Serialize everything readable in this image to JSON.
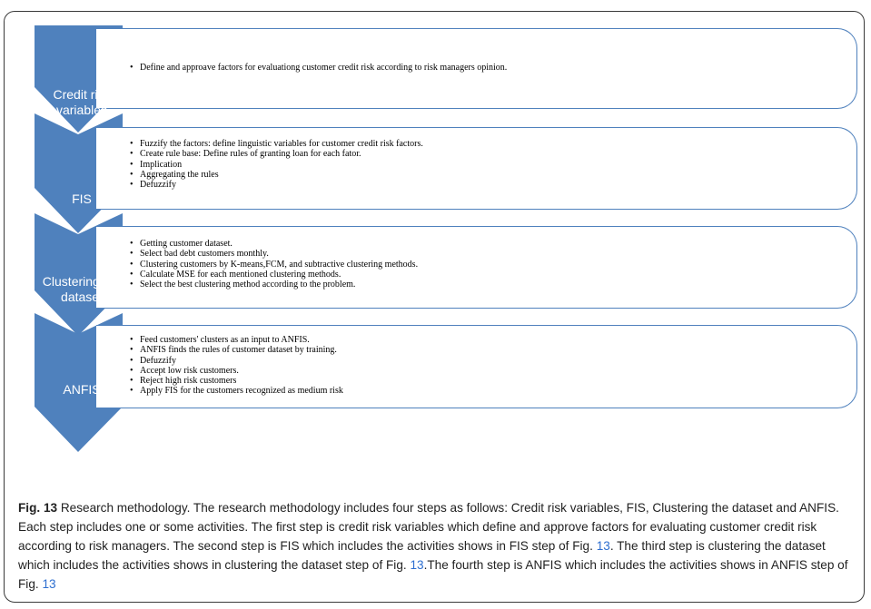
{
  "steps": [
    {
      "label_lines": [
        "Credit risk",
        "variables"
      ],
      "items": [
        "Define and approave factors for  evaluationg customer credit risk according to risk  managers opinion."
      ]
    },
    {
      "label_lines": [
        "FIS"
      ],
      "items": [
        "Fuzzify the factors: define linguistic variables for customer credit risk factors.",
        "Create rule  base: Define rules of granting loan for each fator.",
        "Implication",
        "Aggregating the rules",
        "Defuzzify"
      ]
    },
    {
      "label_lines": [
        "Clustering the",
        "dataset"
      ],
      "items": [
        "Getting  customer dataset.",
        "Select bad debt customers monthly.",
        "Clustering  customers by K-means,FCM, and subtractive clustering methods.",
        "Calculate MSE for each mentioned clustering methods.",
        "Select the best clustering method according to the problem."
      ]
    },
    {
      "label_lines": [
        "ANFIS"
      ],
      "items": [
        "Feed customers' clusters as an input to ANFIS.",
        "ANFIS finds the rules of customer dataset by training.",
        "Defuzzify",
        "Accept low risk customers.",
        "Reject high risk customers",
        "Apply FIS for the customers recognized as medium risk"
      ]
    }
  ],
  "colors": {
    "arrow_fill": "#4f81bd",
    "box_border": "#4f81bd",
    "link": "#2e6fd0"
  },
  "caption": {
    "fig_label": "Fig. 13",
    "title": " Research methodology. The research methodology includes four steps as follows: Credit risk variables, FIS, Clustering the dataset and ANFIS. Each step includes one or some activities. The first step is credit risk variables which define and approve factors for evaluating customer credit risk according to risk managers. The second step is FIS which includes the activities shows in FIS step of Fig. ",
    "ref1": "13",
    "mid1": ". The third step is clustering the dataset which includes the activities shows in clustering the dataset step of Fig. ",
    "ref2": "13",
    "mid2": ".The fourth step is ANFIS which includes the activities shows in ANFIS step of Fig. ",
    "ref3": "13"
  }
}
